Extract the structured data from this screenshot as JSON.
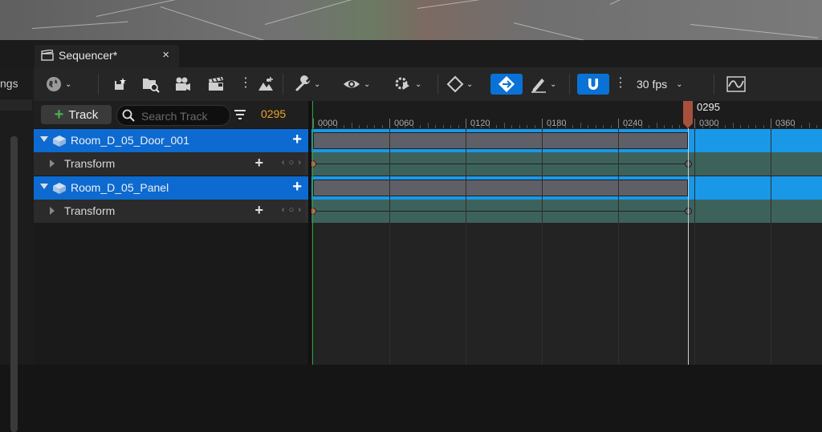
{
  "window": {
    "left_label": "ngs",
    "tab": {
      "title": "Sequencer*",
      "close": "×"
    }
  },
  "toolbar": {
    "fps_label": "30 fps"
  },
  "tracks_panel": {
    "add_track_label": "Track",
    "search_placeholder": "Search Track",
    "current_frame": "0295",
    "rows": [
      {
        "type": "object",
        "label": "Room_D_05_Door_001"
      },
      {
        "type": "sub",
        "label": "Transform"
      },
      {
        "type": "object",
        "label": "Room_D_05_Panel"
      },
      {
        "type": "sub",
        "label": "Transform"
      }
    ]
  },
  "timeline": {
    "ruler_labels": [
      "0000",
      "0060",
      "0120",
      "0180",
      "0240",
      "0300",
      "0360"
    ],
    "playhead_label": "0295"
  },
  "colors": {
    "accent": "#0a72d6",
    "object_lane": "#1998e8",
    "sub_lane": "#3d625c",
    "current_frame": "#e8a52b",
    "playhead": "#a8503c"
  }
}
